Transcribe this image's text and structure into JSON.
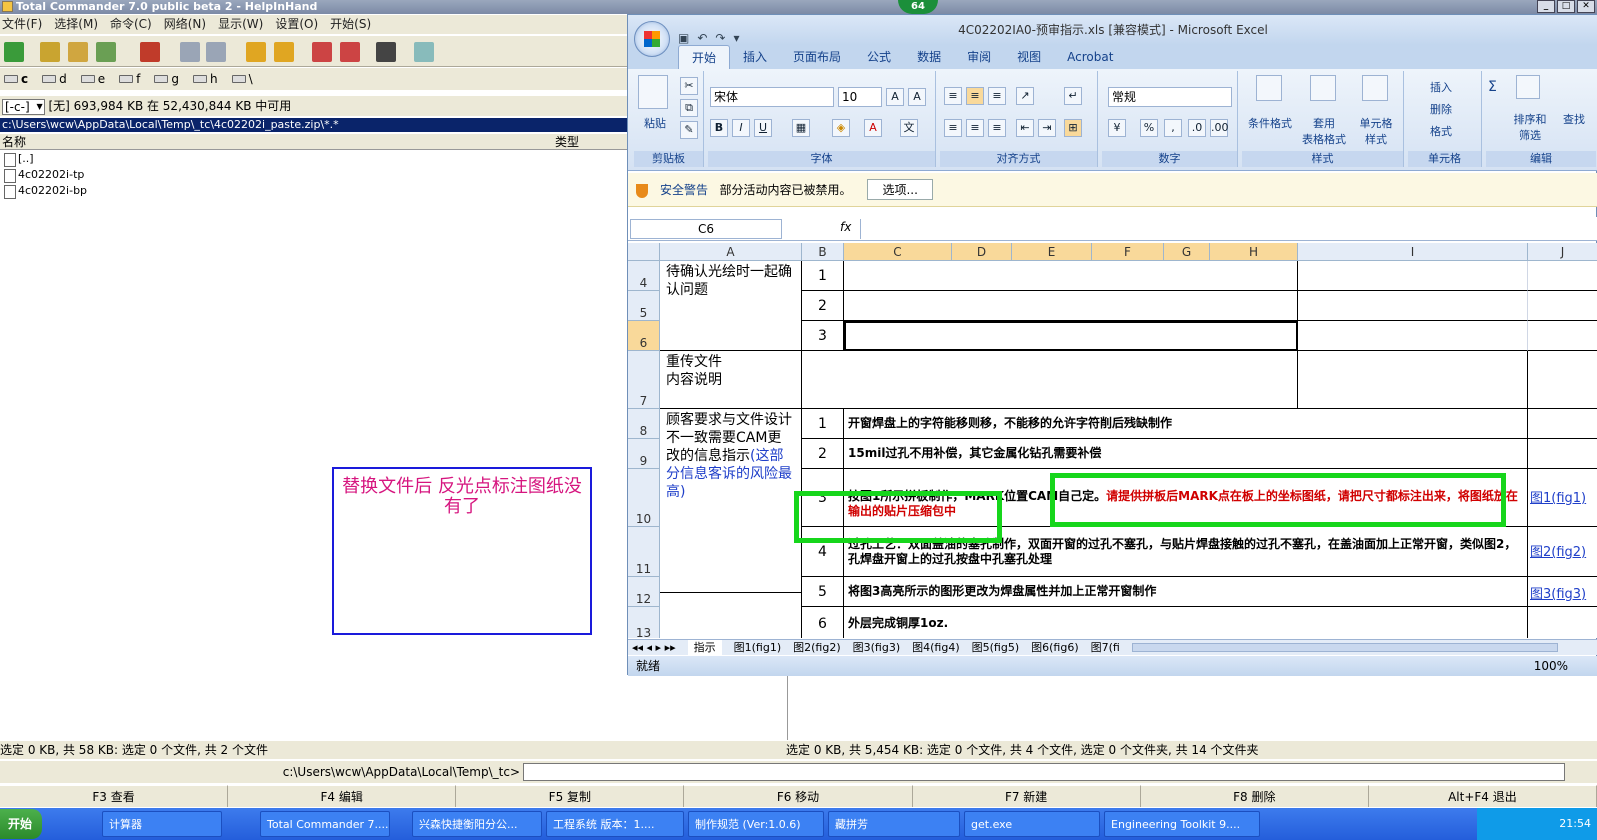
{
  "tc": {
    "title": "Total Commander 7.0 public beta 2 - HelpInHand",
    "menu": [
      "文件(F)",
      "选择(M)",
      "命令(C)",
      "网络(N)",
      "显示(W)",
      "设置(O)",
      "开始(S)"
    ],
    "drives": [
      "c",
      "d",
      "e",
      "f",
      "g",
      "h",
      "\\"
    ],
    "drive_combo": "[-c-]",
    "free_space": "[无]  693,984 KB 在 52,430,844 KB 中可用",
    "path": "c:\\Users\\wcw\\AppData\\Local\\Temp\\_tc\\4c02202i_paste.zip\\*.*",
    "col_name": "名称",
    "col_type": "类型",
    "files": [
      "[..]",
      "4c02202i-tp",
      "4c02202i-bp"
    ],
    "status_left": "选定 0 KB, 共 58 KB: 选定 0 个文件, 共 2 个文件",
    "status_right": "选定 0 KB, 共 5,454 KB: 选定 0 个文件, 共 4 个文件, 选定 0 个文件夹, 共 14 个文件夹",
    "cmd_path": "c:\\Users\\wcw\\AppData\\Local\\Temp\\_tc>",
    "fkeys": [
      "F3 查看",
      "F4 编辑",
      "F5 复制",
      "F6 移动",
      "F7 新建",
      "F8 删除",
      "Alt+F4 退出"
    ]
  },
  "badge": "64",
  "excel": {
    "title": "4C02202IA0-预审指示.xls  [兼容模式] - Microsoft Excel",
    "tabs": [
      "开始",
      "插入",
      "页面布局",
      "公式",
      "数据",
      "审阅",
      "视图",
      "Acrobat"
    ],
    "groups": {
      "clipboard": "剪贴板",
      "font": "字体",
      "align": "对齐方式",
      "number": "数字",
      "styles": "样式",
      "cells": "单元格",
      "edit": "编辑"
    },
    "paste": "粘贴",
    "font_name": "宋体",
    "font_size": "10",
    "number_format": "常规",
    "styles_btns": [
      "条件格式",
      "套用\n表格格式",
      "单元格\n样式"
    ],
    "cell_btns": [
      "插入",
      "删除",
      "格式"
    ],
    "edit_btns": [
      "排序和\n筛选",
      "查找"
    ],
    "security_label": "安全警告",
    "security_msg": "部分活动内容已被禁用。",
    "security_btn": "选项...",
    "namebox": "C6",
    "fx": "fx",
    "columns": [
      "A",
      "B",
      "C",
      "D",
      "E",
      "F",
      "G",
      "H",
      "I",
      "J"
    ],
    "rows": [
      "4",
      "5",
      "6",
      "7",
      "8",
      "9",
      "10",
      "11",
      "12",
      "13"
    ],
    "a4": "待确认光绘时一起确认问题",
    "a7": "重传文件\n内容说明",
    "a8_black": "顾客要求与文件设计不一致需要CAM更改的信息指示",
    "a8_blue": "(这部分信息客诉的风险最高)",
    "nums": [
      "1",
      "2",
      "3",
      "1",
      "2",
      "3",
      "4",
      "5",
      "6"
    ],
    "r8": "开窗焊盘上的字符能移则移，不能移的允许字符削后残缺制作",
    "r9": "15mil过孔不用补偿，其它金属化钻孔需要补偿",
    "r10_black": "按图1所示拼板制作，MARK位置CAM自己定。",
    "r10_red": "请提供拼板后MARK点在板上的坐标图纸，请把尺寸都标注出来，将图纸放在输出的贴片压缩包中",
    "r11": "过孔工艺：双面盖油的塞孔制作，双面开窗的过孔不塞孔，与贴片焊盘接触的过孔不塞孔，在盖油面加上正常开窗，类似图2，孔焊盘开窗上的过孔按盘中孔塞孔处理",
    "r12": "将图3高亮所示的图形更改为焊盘属性并加上正常开窗制作",
    "r13": "外层完成铜厚1oz.",
    "links": [
      "图1(fig1)",
      "图2(fig2)",
      "图3(fig3)"
    ],
    "sheet_tabs": [
      "指示",
      "图1(fig1)",
      "图2(fig2)",
      "图3(fig3)",
      "图4(fig4)",
      "图5(fig5)",
      "图6(fig6)",
      "图7(fi"
    ],
    "status": "就绪",
    "zoom": "100%"
  },
  "annotation": "替换文件后    反光点标注图纸没有了",
  "taskbar": {
    "start": "开始",
    "items": [
      "计算器",
      "Total Commander 7....",
      "兴森快捷衡阳分公...",
      "工程系统  版本：1....",
      "制作规范 (Ver:1.0.6)",
      "藏拼芳",
      "get.exe",
      "Engineering Toolkit 9...."
    ],
    "time": "21:54"
  }
}
